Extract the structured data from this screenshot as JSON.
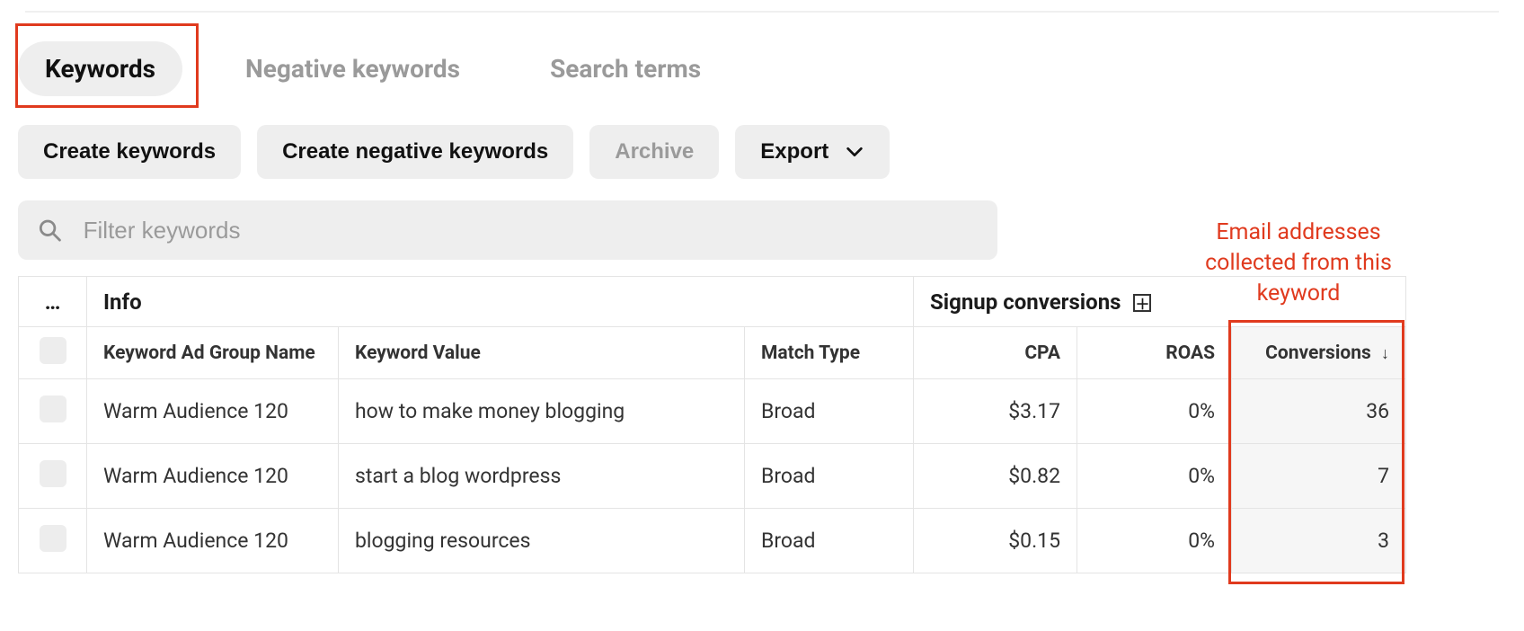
{
  "tabs": {
    "keywords": "Keywords",
    "negative": "Negative keywords",
    "search_terms": "Search terms"
  },
  "toolbar": {
    "create_keywords": "Create keywords",
    "create_negative": "Create negative keywords",
    "archive": "Archive",
    "export": "Export"
  },
  "filter": {
    "placeholder": "Filter keywords"
  },
  "annotation": {
    "conversions_note": "Email addresses collected from this keyword"
  },
  "table": {
    "group_row": {
      "menu": "…",
      "info": "Info",
      "signup": "Signup conversions"
    },
    "headers": {
      "adgroup": "Keyword Ad Group Name",
      "kwvalue": "Keyword Value",
      "match": "Match Type",
      "cpa": "CPA",
      "roas": "ROAS",
      "conversions": "Conversions"
    },
    "rows": [
      {
        "adgroup": "Warm Audience 120",
        "kwvalue": "how to make money blogging",
        "match": "Broad",
        "cpa": "$3.17",
        "roas": "0%",
        "conversions": "36"
      },
      {
        "adgroup": "Warm Audience 120",
        "kwvalue": "start a blog wordpress",
        "match": "Broad",
        "cpa": "$0.82",
        "roas": "0%",
        "conversions": "7"
      },
      {
        "adgroup": "Warm Audience 120",
        "kwvalue": "blogging resources",
        "match": "Broad",
        "cpa": "$0.15",
        "roas": "0%",
        "conversions": "3"
      }
    ]
  }
}
